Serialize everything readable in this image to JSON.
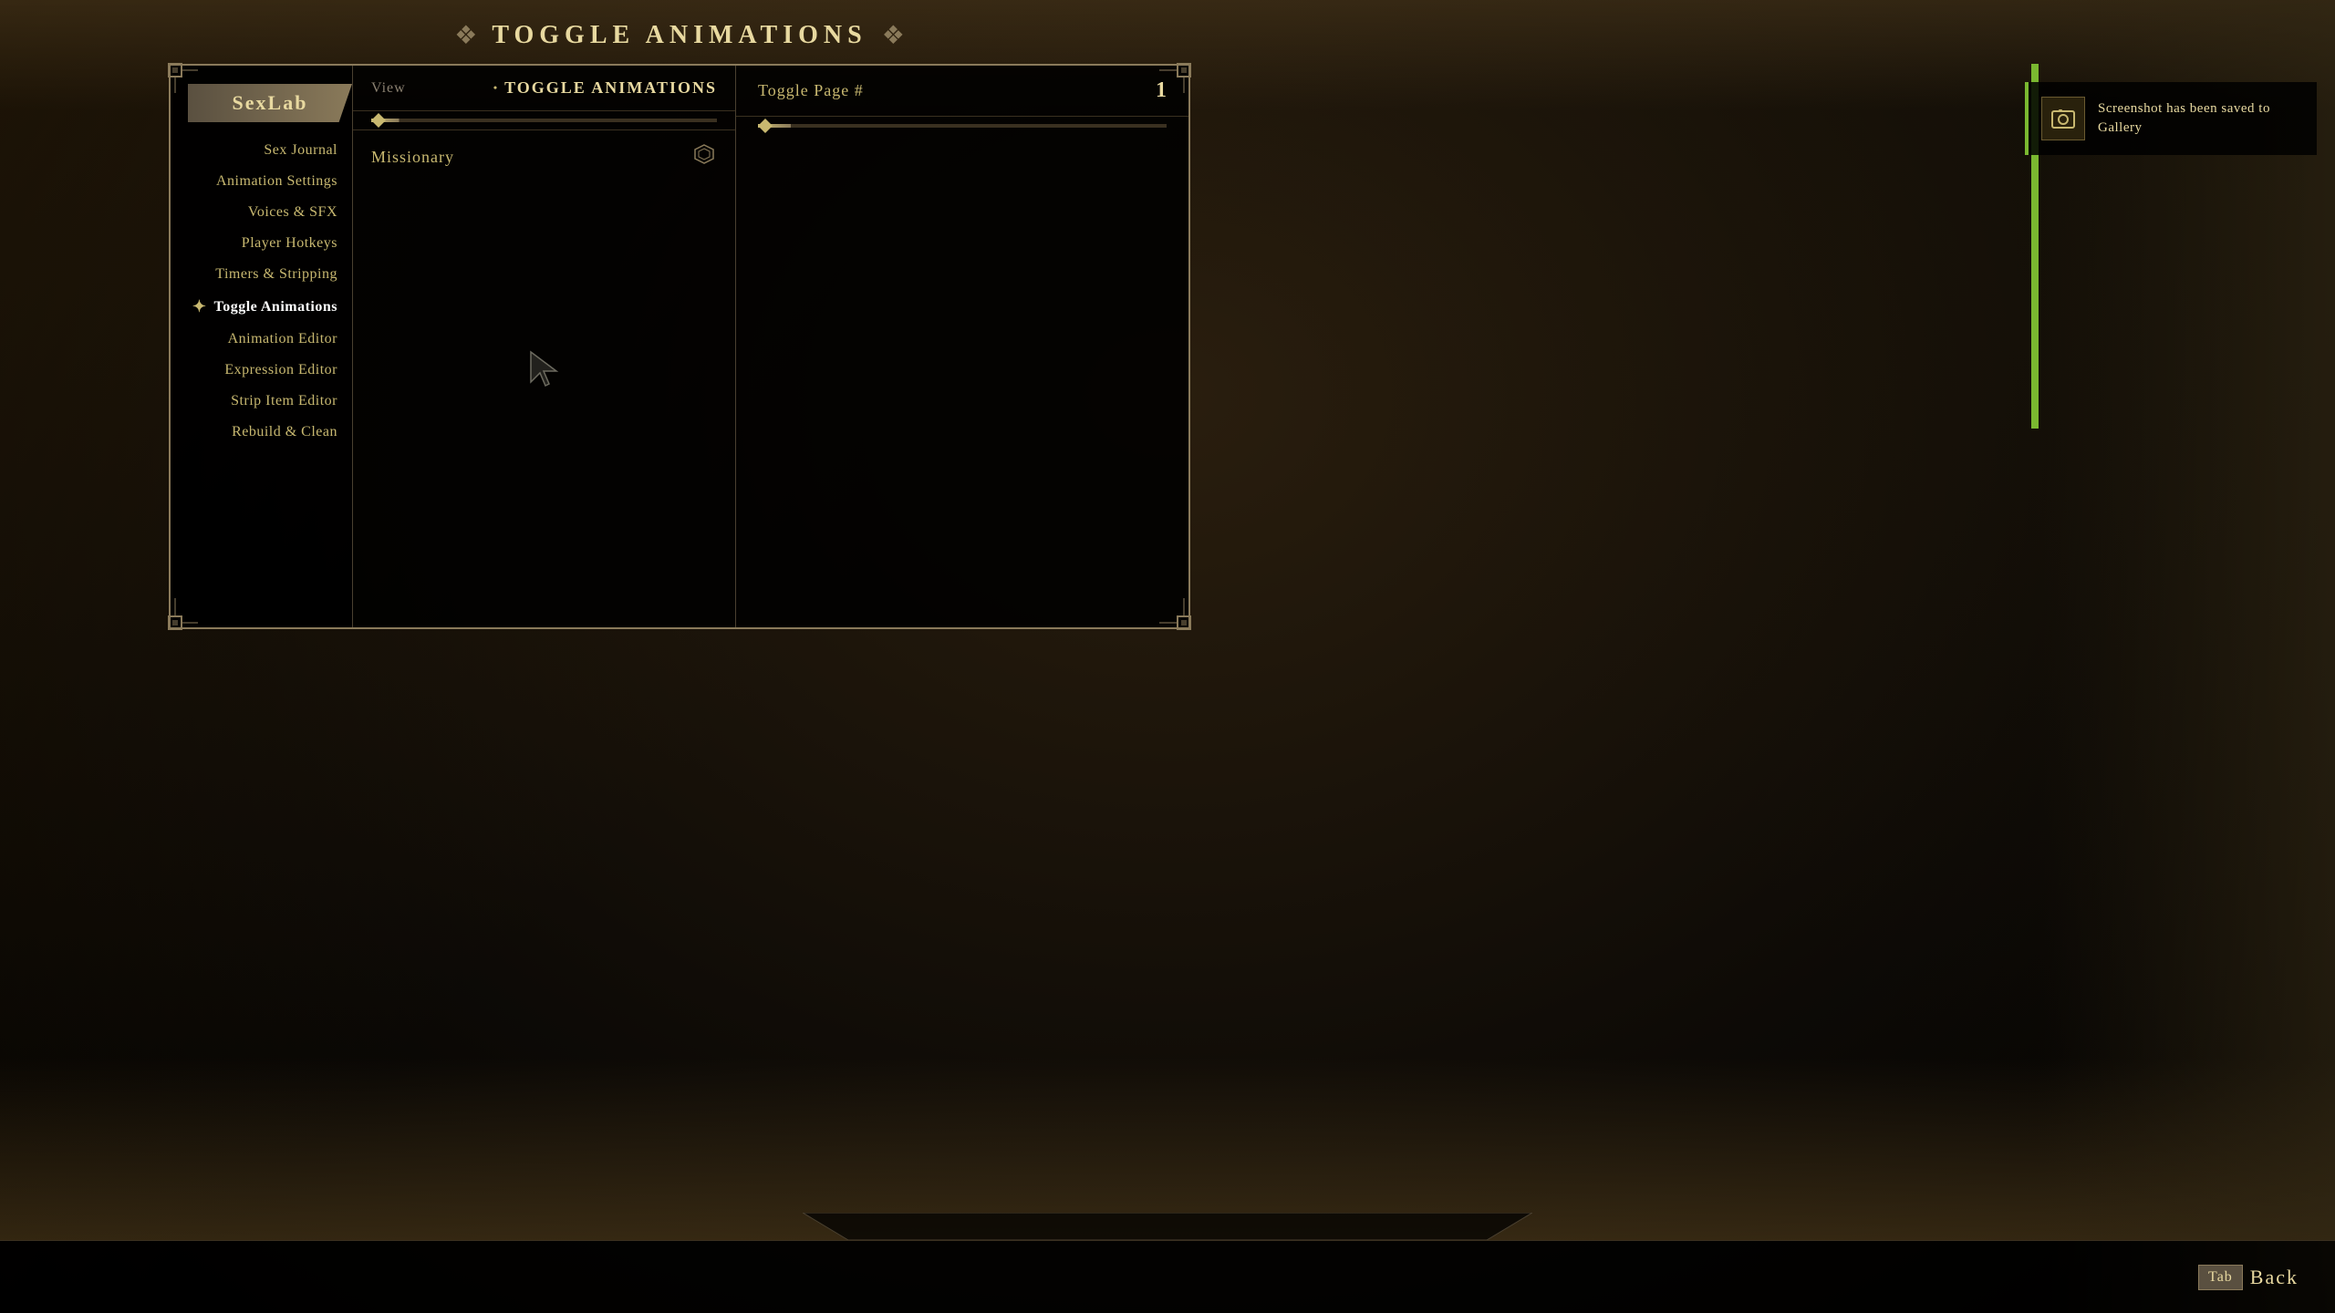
{
  "title": "TOGGLE ANIMATIONS",
  "sidebar": {
    "title": "SexLab",
    "items": [
      {
        "id": "sex-journal",
        "label": "Sex Journal",
        "active": false
      },
      {
        "id": "animation-settings",
        "label": "Animation Settings",
        "active": false
      },
      {
        "id": "voices-sfx",
        "label": "Voices & SFX",
        "active": false
      },
      {
        "id": "player-hotkeys",
        "label": "Player Hotkeys",
        "active": false
      },
      {
        "id": "timers-stripping",
        "label": "Timers & Stripping",
        "active": false
      },
      {
        "id": "toggle-animations",
        "label": "Toggle Animations",
        "active": true
      },
      {
        "id": "animation-editor",
        "label": "Animation Editor",
        "active": false
      },
      {
        "id": "expression-editor",
        "label": "Expression Editor",
        "active": false
      },
      {
        "id": "strip-item-editor",
        "label": "Strip Item Editor",
        "active": false
      },
      {
        "id": "rebuild-clean",
        "label": "Rebuild & Clean",
        "active": false
      }
    ]
  },
  "middle_panel": {
    "view_label": "View",
    "view_value": "TOGGLE ANIMATIONS",
    "animation_item": "Missionary"
  },
  "right_panel": {
    "toggle_page_label": "Toggle Page #",
    "toggle_page_value": "1"
  },
  "notification": {
    "text": "Screenshot has been saved to Gallery"
  },
  "bottom": {
    "tab_label": "Tab",
    "back_label": "Back"
  },
  "icons": {
    "title_ornament_left": "❖",
    "title_ornament_right": "❖",
    "active_menu_icon": "✦",
    "anim_icon": "✦",
    "notif_icon": "📷"
  }
}
